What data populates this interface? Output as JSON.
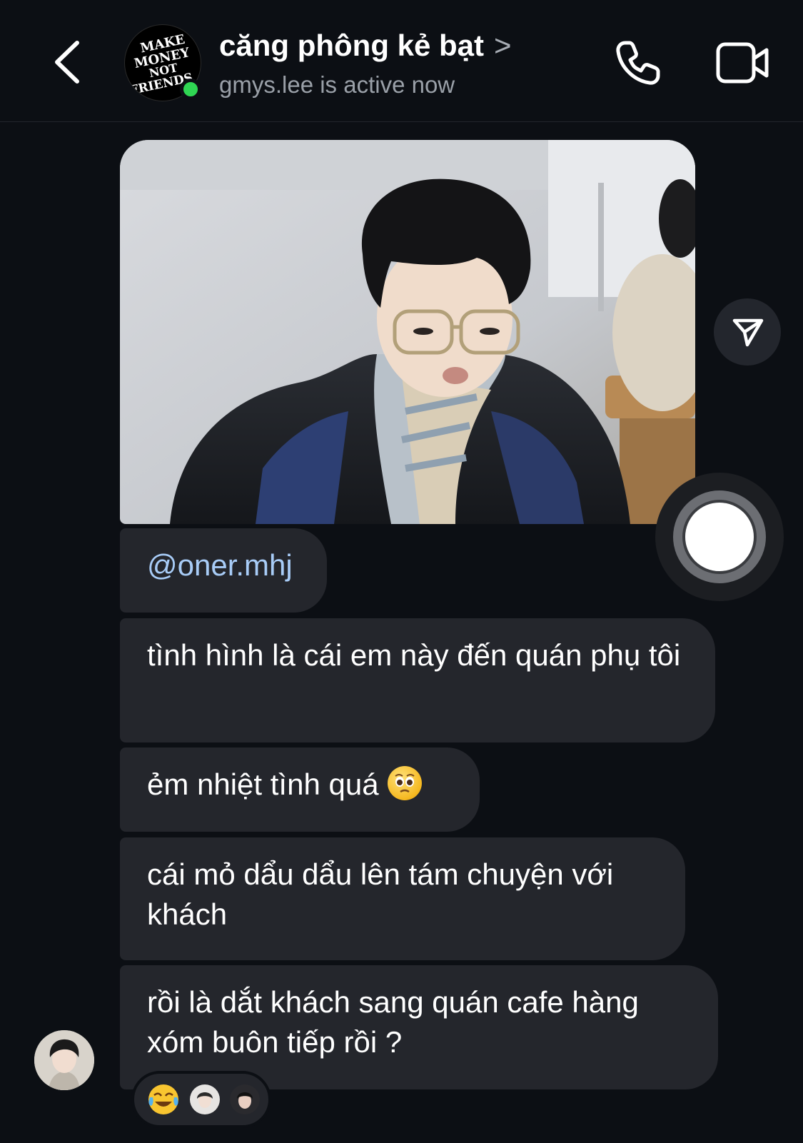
{
  "header": {
    "back_label": "back",
    "avatar_text": [
      "MAKE",
      "MONEY",
      "NOT",
      "FRIENDS"
    ],
    "title": "căng phông kẻ bạt",
    "title_chevron": ">",
    "status": "gmys.lee is active now",
    "online_color": "#2fd653",
    "icons": {
      "back": "chevron-left-icon",
      "call": "phone-icon",
      "video": "video-camera-icon"
    }
  },
  "message_photo": {
    "share_icon": "paper-plane-icon",
    "shutter_icon": "camera-shutter-icon"
  },
  "messages": [
    {
      "text": "@oner.mhj"
    },
    {
      "text": "tình hình là cái em này đến quán phụ tôi"
    },
    {
      "text": "ẻm nhiệt tình quá",
      "emoji": "pleading-face-emoji"
    },
    {
      "text": "cái mỏ dẩu dẩu lên tám chuyện với khách"
    },
    {
      "text": "rồi là dắt khách sang quán cafe hàng xóm buôn tiếp rồi ?"
    }
  ],
  "reactions": [
    "tears-of-joy-emoji",
    "reactor-avatar",
    "reactor-avatar"
  ],
  "colors": {
    "background": "#0c0f14",
    "bubble": "#24262c",
    "mention": "#a8ccf7"
  }
}
